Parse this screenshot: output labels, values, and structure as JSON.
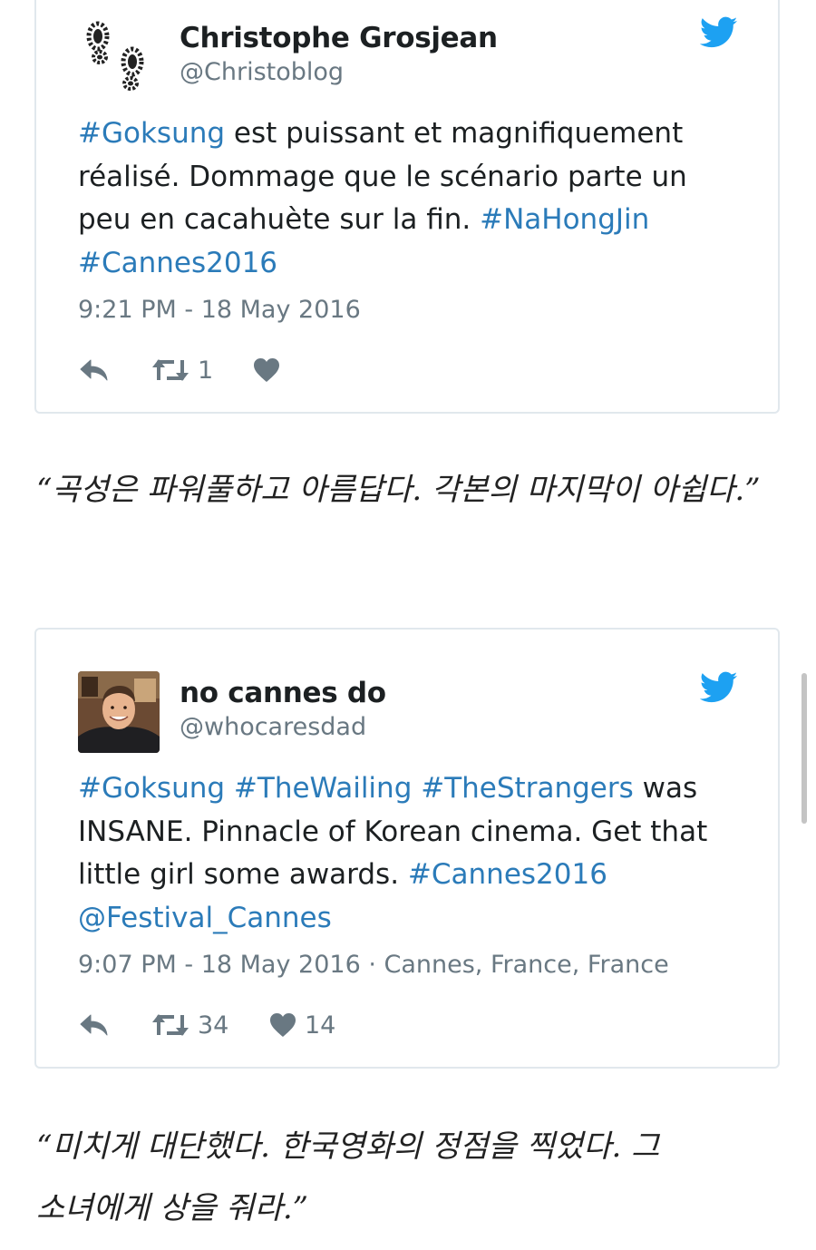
{
  "tweets": [
    {
      "author_name": "Christophe Grosjean",
      "author_handle": "@Christoblog",
      "avatar_icon": "footprints-icon",
      "text_parts": [
        {
          "text": "#Goksung",
          "type": "hashtag"
        },
        {
          "text": " est puissant et magnifiquement réalisé. Dommage que le scénario parte un peu en cacahuète sur la fin. ",
          "type": "text"
        },
        {
          "text": "#NaHongJin",
          "type": "hashtag"
        },
        {
          "text": " ",
          "type": "text"
        },
        {
          "text": "#Cannes2016",
          "type": "hashtag"
        }
      ],
      "meta": "9:21 PM - 18 May 2016",
      "retweet_count": "1",
      "like_count": ""
    },
    {
      "author_name": "no cannes do",
      "author_handle": "@whocaresdad",
      "avatar_icon": "user-photo",
      "text_parts": [
        {
          "text": "#Goksung",
          "type": "hashtag"
        },
        {
          "text": " ",
          "type": "text"
        },
        {
          "text": "#TheWailing",
          "type": "hashtag"
        },
        {
          "text": " ",
          "type": "text"
        },
        {
          "text": "#TheStrangers",
          "type": "hashtag"
        },
        {
          "text": " was INSANE. Pinnacle of Korean cinema. Get that little girl some awards. ",
          "type": "text"
        },
        {
          "text": "#Cannes2016",
          "type": "hashtag"
        },
        {
          "text": " ",
          "type": "text"
        },
        {
          "text": "@Festival_Cannes",
          "type": "hashtag"
        }
      ],
      "meta": "9:07 PM - 18 May 2016 · Cannes, France, France",
      "retweet_count": "34",
      "like_count": "14"
    }
  ],
  "quotes": [
    "“곡성은 파워풀하고 아름답다. 각본의 마지막이 아쉽다.”",
    "“미치게 대단했다. 한국영화의 정점을 찍었다. 그 소녀에게 상을 줘라.”"
  ],
  "icons": {
    "bird": "twitter-bird-icon",
    "reply": "reply-icon",
    "retweet": "retweet-icon",
    "like": "heart-icon"
  },
  "colors": {
    "link": "#2b7bb9",
    "bird": "#1da1f2",
    "muted": "#697882",
    "border": "#e1e8ed"
  }
}
